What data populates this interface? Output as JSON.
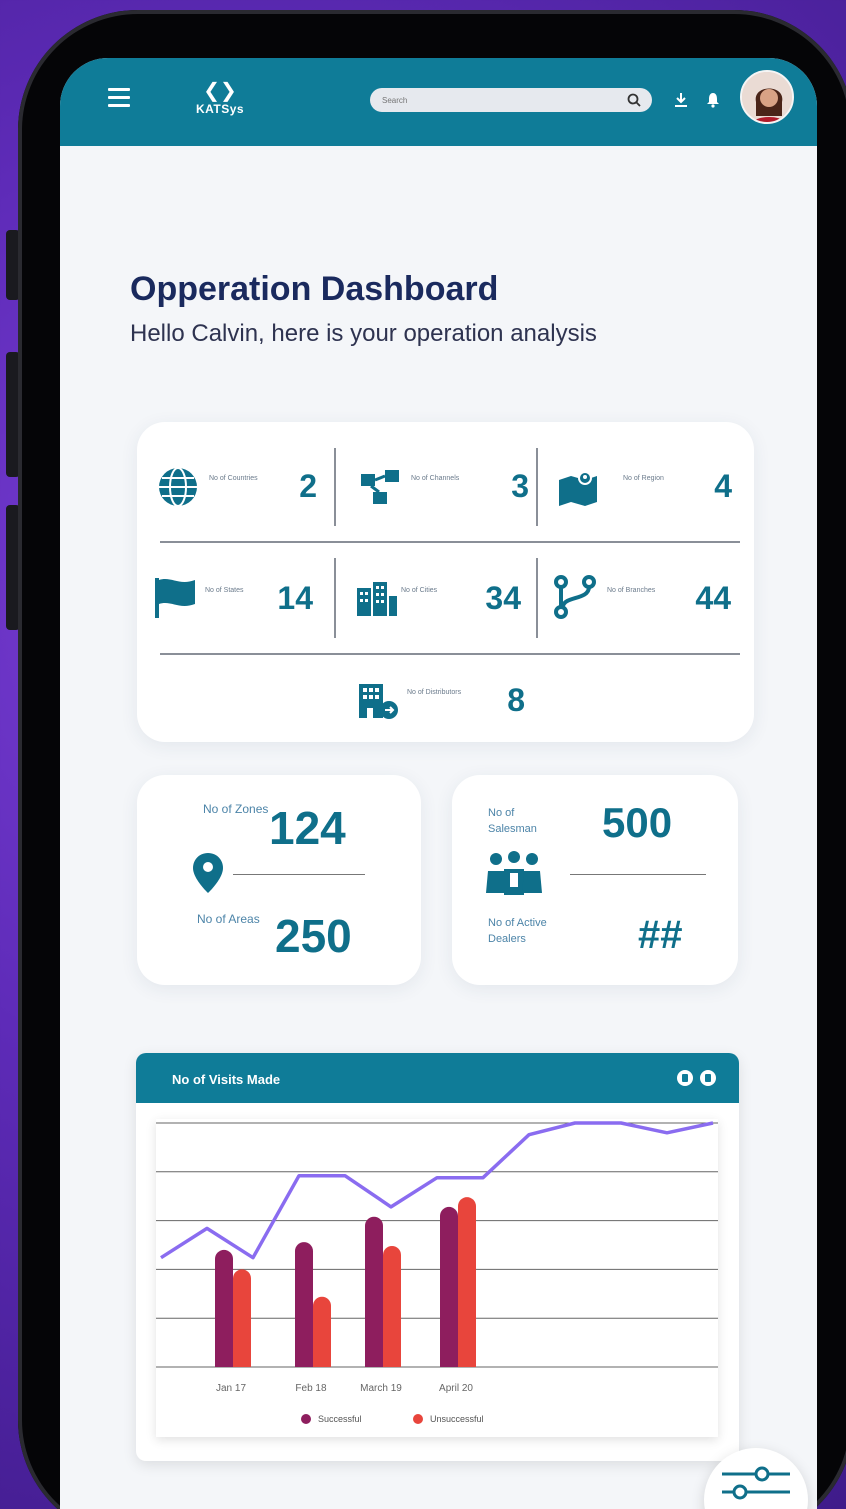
{
  "header": {
    "logo_text": "KATSys",
    "search_placeholder": "Search"
  },
  "page": {
    "title": "Opperation Dashboard",
    "subtitle": "Hello Calvin, here is your operation analysis"
  },
  "stats": [
    {
      "label": "No of Countries",
      "value": "2",
      "icon": "globe-icon"
    },
    {
      "label": "No of Channels",
      "value": "3",
      "icon": "channels-icon"
    },
    {
      "label": "No of Region",
      "value": "4",
      "icon": "map-icon"
    },
    {
      "label": "No of States",
      "value": "14",
      "icon": "flag-icon"
    },
    {
      "label": "No of Cities",
      "value": "34",
      "icon": "city-icon"
    },
    {
      "label": "No of Branches",
      "value": "44",
      "icon": "branch-icon"
    },
    {
      "label": "No of Distributors",
      "value": "8",
      "icon": "distributor-icon"
    }
  ],
  "zones_card": {
    "zones_label": "No of Zones",
    "zones_value": "124",
    "areas_label": "No of Areas",
    "areas_value": "250"
  },
  "sales_card": {
    "salesman_label": "No of Salesman",
    "salesman_value": "500",
    "dealers_label": "No of Active Dealers",
    "dealers_value": "##"
  },
  "chart_data": {
    "type": "bar",
    "title": "No of Visits Made",
    "categories": [
      "Jan 17",
      "Feb 18",
      "March 19",
      "April 20"
    ],
    "series": [
      {
        "name": "Successful",
        "values": [
          60,
          64,
          77,
          82
        ],
        "color": "#8e1e5e"
      },
      {
        "name": "Unsuccessful",
        "values": [
          50,
          36,
          62,
          87
        ],
        "color": "#e8453c"
      }
    ],
    "trend_line": {
      "type": "line",
      "values": [
        56,
        71,
        56,
        98,
        98,
        82,
        97,
        97,
        119,
        125,
        125,
        120,
        125
      ],
      "color": "#8a6cf0"
    },
    "ylim": [
      0,
      125
    ],
    "grid": true,
    "legend_position": "bottom"
  },
  "colors": {
    "brand": "#0f7c98",
    "title": "#1a2a5e",
    "value": "#0f6f8a"
  }
}
